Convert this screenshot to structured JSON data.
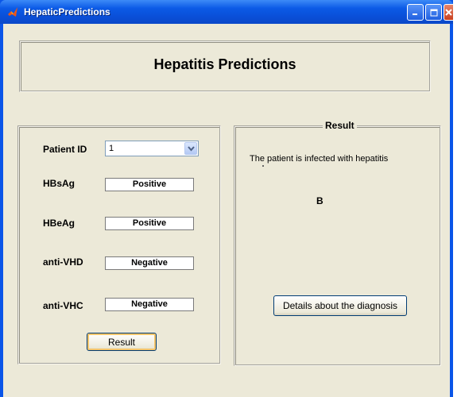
{
  "window": {
    "title": "HepaticPredictions",
    "icon": "matlab-icon"
  },
  "header": {
    "title": "Hepatitis Predictions"
  },
  "inputs": {
    "patient_id_label": "Patient ID",
    "patient_id_value": "1",
    "hbsag_label": "HBsAg",
    "hbsag_value": "Positive",
    "hbeag_label": "HBeAg",
    "hbeag_value": "Positive",
    "anti_vhd_label": "anti-VHD",
    "anti_vhd_value": "Negative",
    "anti_vhc_label": "anti-VHC",
    "anti_vhc_value": "Negative",
    "result_button": "Result"
  },
  "result": {
    "title": "Result",
    "message": "The patient is infected with hepatitis",
    "type": "B",
    "details_button": "Details about the diagnosis"
  },
  "colors": {
    "titlebar": "#0b5ae6",
    "window_bg": "#ece9d8",
    "close_button": "#c8401f"
  }
}
